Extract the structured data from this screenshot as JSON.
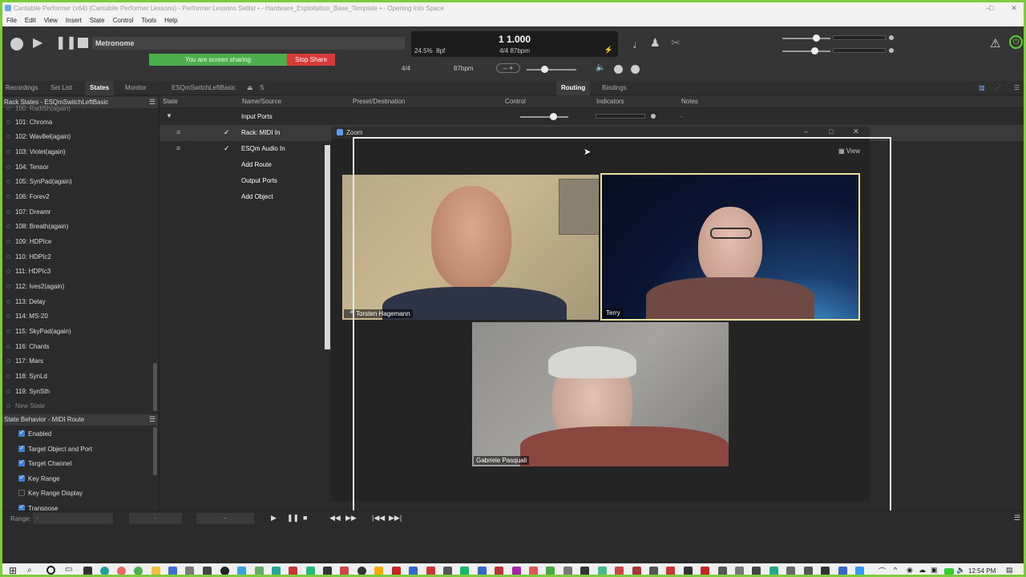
{
  "window": {
    "title": "Cantabile Performer (x64) (Cantabile Performer Lessons) - Performer Lessons Setlist • - Hardware_Exploitation_Base_Template • - Opening Into Space"
  },
  "menu": [
    "File",
    "Edit",
    "View",
    "Insert",
    "State",
    "Control",
    "Tools",
    "Help"
  ],
  "transport": {
    "metronome_label": "Metronome",
    "position": "1 1.000",
    "cpu_load": "24.5%",
    "bpf": "8pf",
    "time_info": "4/4 87bpm",
    "time_signature": "4/4",
    "tempo": "87bpm",
    "screen_sharing": "You are screen sharing",
    "stop_share": "Stop Share"
  },
  "tabs": {
    "recordings": "Recordings",
    "setlist": "Set List",
    "states": "States",
    "monitor": "Monitor",
    "song_name": "ESQmSwitchLeftBasic",
    "song_s": "S",
    "routing": "Routing",
    "bindings": "Bindings"
  },
  "rack_states": {
    "header": "Rack States - ESQmSwitchLeftBasic",
    "items": [
      "100: RadiSh(again)",
      "101: Chroma",
      "102: Wav8el(again)",
      "103: Violet(again)",
      "104: Tensor",
      "105: SynPad(again)",
      "106: Forev2",
      "107: Dreamr",
      "108: Breath(again)",
      "109: HDPIce",
      "110: HDPIc2",
      "111: HDPIc3",
      "112: Ives2(again)",
      "113: Delay",
      "114: MS-20",
      "115: SkyPad(again)",
      "116: Chants",
      "117: Mars",
      "118: SynLd",
      "119: SynSth"
    ],
    "new_state": "New State"
  },
  "state_behavior": {
    "header": "State Behavior - MIDI Route",
    "items": [
      {
        "label": "Enabled",
        "checked": true
      },
      {
        "label": "Target Object and Port",
        "checked": true
      },
      {
        "label": "Target Channel",
        "checked": true
      },
      {
        "label": "Key Range",
        "checked": true
      },
      {
        "label": "Key Range Display",
        "checked": false
      },
      {
        "label": "Transpose",
        "checked": true
      }
    ]
  },
  "grid": {
    "headers": {
      "state": "State",
      "name": "Name/Source",
      "preset": "Preset/Destination",
      "control": "Control",
      "indicators": "Indicators",
      "notes": "Notes"
    },
    "input_ports": "Input Ports",
    "rows": [
      {
        "name": "Rack: MIDI In",
        "checked": true
      },
      {
        "name": "ESQm Audio In",
        "checked": true
      }
    ],
    "add_route": "Add Route",
    "output_ports": "Output Ports",
    "add_object": "Add Object",
    "notes_dash": "-"
  },
  "zoom": {
    "title": "Zoom",
    "view": "View",
    "participants": {
      "p1": "Torsten Hagemann",
      "p2": "Terry",
      "p3": "Gabriele Pasquali"
    }
  },
  "bottom": {
    "range_label": "Range:",
    "range_value": "-",
    "field2": "-",
    "field3": "-"
  },
  "taskbar": {
    "time": "12:54 PM"
  },
  "colors": {
    "share_green": "#4cae4c",
    "stop_red": "#d83a3a",
    "frame_green": "#7ccc3c",
    "check_blue": "#3f7fd6"
  }
}
